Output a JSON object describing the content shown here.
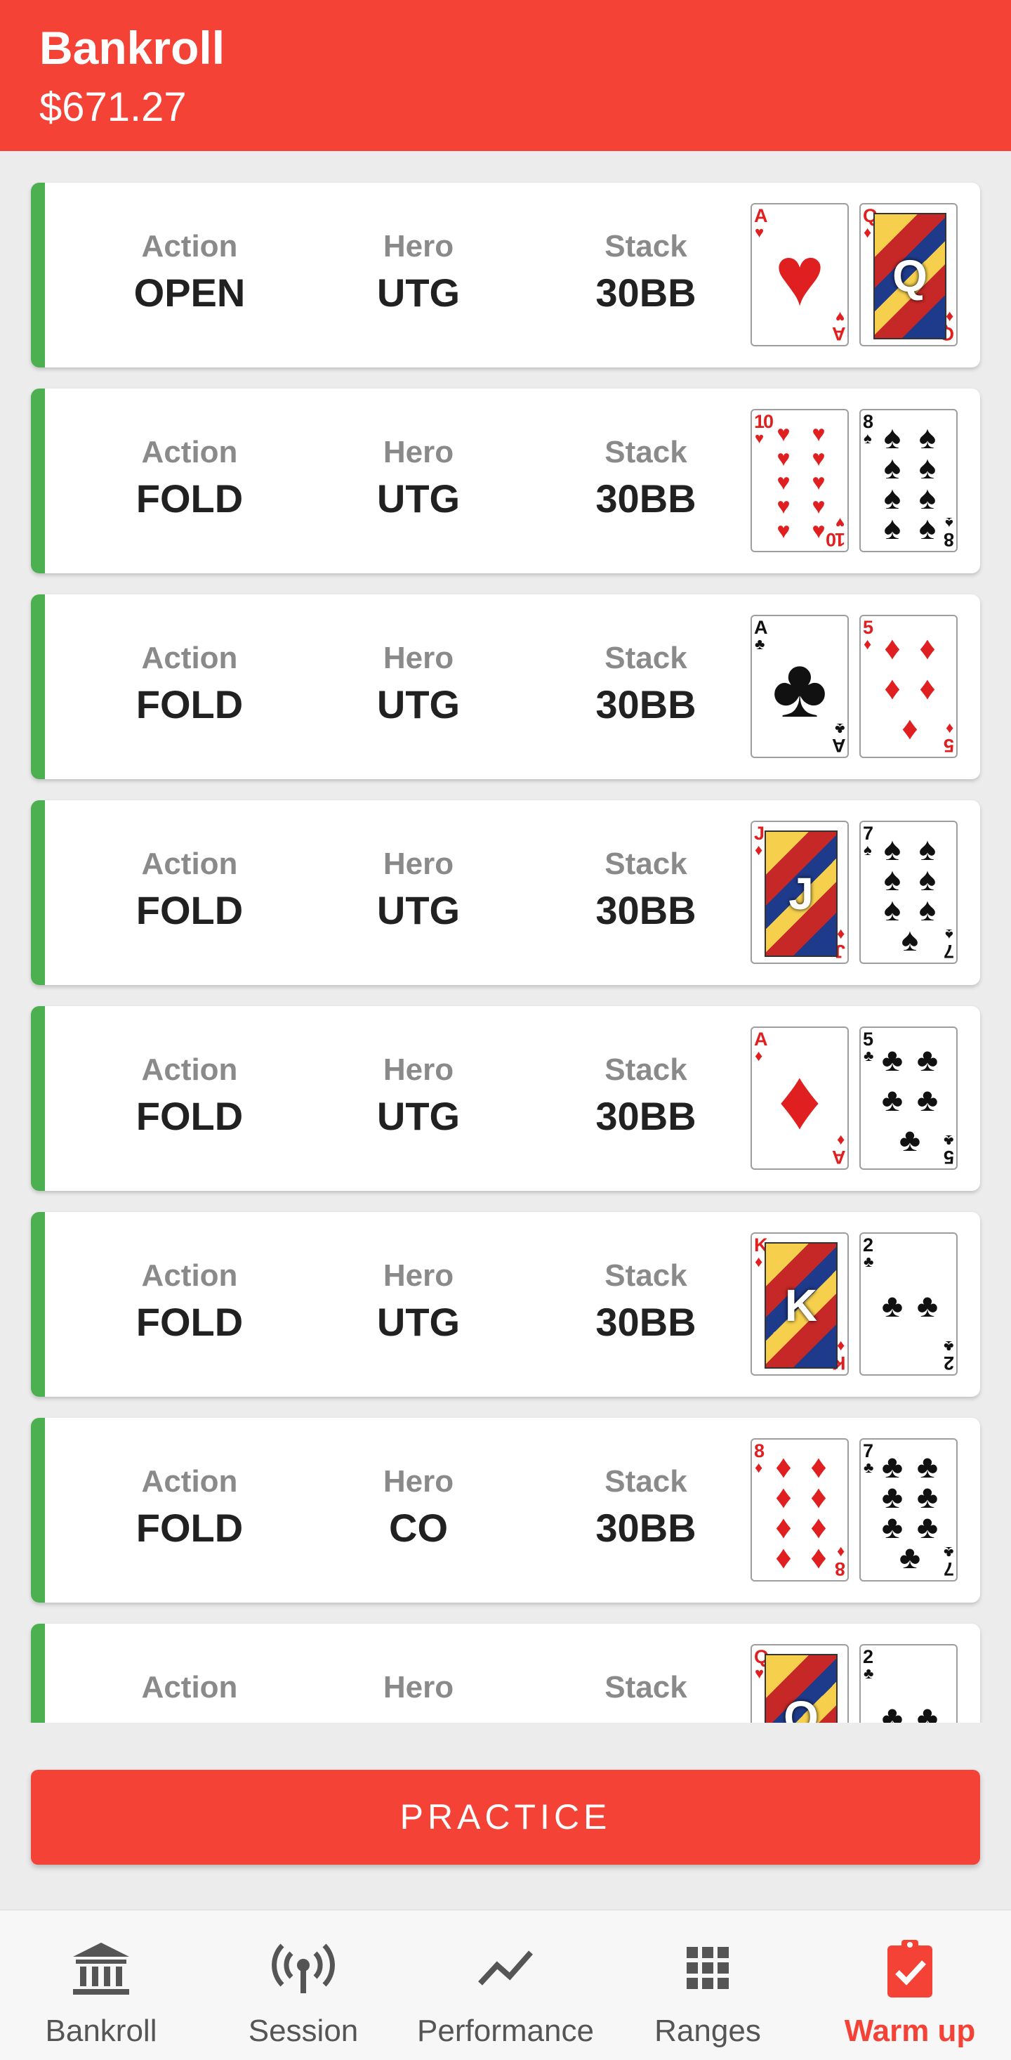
{
  "header": {
    "title": "Bankroll",
    "amount": "$671.27"
  },
  "labels": {
    "action": "Action",
    "hero": "Hero",
    "stack": "Stack"
  },
  "hands": [
    {
      "action": "OPEN",
      "hero": "UTG",
      "stack": "30BB",
      "cards": [
        {
          "rank": "A",
          "suit": "♥",
          "color": "red"
        },
        {
          "rank": "Q",
          "suit": "♦",
          "color": "red"
        }
      ]
    },
    {
      "action": "FOLD",
      "hero": "UTG",
      "stack": "30BB",
      "cards": [
        {
          "rank": "10",
          "suit": "♥",
          "color": "red"
        },
        {
          "rank": "8",
          "suit": "♠",
          "color": "black"
        }
      ]
    },
    {
      "action": "FOLD",
      "hero": "UTG",
      "stack": "30BB",
      "cards": [
        {
          "rank": "A",
          "suit": "♣",
          "color": "black"
        },
        {
          "rank": "5",
          "suit": "♦",
          "color": "red"
        }
      ]
    },
    {
      "action": "FOLD",
      "hero": "UTG",
      "stack": "30BB",
      "cards": [
        {
          "rank": "J",
          "suit": "♦",
          "color": "red"
        },
        {
          "rank": "7",
          "suit": "♠",
          "color": "black"
        }
      ]
    },
    {
      "action": "FOLD",
      "hero": "UTG",
      "stack": "30BB",
      "cards": [
        {
          "rank": "A",
          "suit": "♦",
          "color": "red"
        },
        {
          "rank": "5",
          "suit": "♣",
          "color": "black"
        }
      ]
    },
    {
      "action": "FOLD",
      "hero": "UTG",
      "stack": "30BB",
      "cards": [
        {
          "rank": "K",
          "suit": "♦",
          "color": "red"
        },
        {
          "rank": "2",
          "suit": "♣",
          "color": "black"
        }
      ]
    },
    {
      "action": "FOLD",
      "hero": "CO",
      "stack": "30BB",
      "cards": [
        {
          "rank": "8",
          "suit": "♦",
          "color": "red"
        },
        {
          "rank": "7",
          "suit": "♣",
          "color": "black"
        }
      ]
    },
    {
      "action": "",
      "hero": "",
      "stack": "",
      "cards": [
        {
          "rank": "Q",
          "suit": "♥",
          "color": "red"
        },
        {
          "rank": "2",
          "suit": "♣",
          "color": "black"
        }
      ]
    }
  ],
  "practice_label": "PRACTICE",
  "nav": [
    {
      "label": "Bankroll",
      "icon": "bank-icon",
      "active": false
    },
    {
      "label": "Session",
      "icon": "broadcast-icon",
      "active": false
    },
    {
      "label": "Performance",
      "icon": "trend-icon",
      "active": false
    },
    {
      "label": "Ranges",
      "icon": "grid-icon",
      "active": false
    },
    {
      "label": "Warm up",
      "icon": "clipboard-check-icon",
      "active": true
    }
  ],
  "colors": {
    "primary": "#f44336",
    "accent_bar": "#4caf50",
    "background": "#ececec"
  }
}
